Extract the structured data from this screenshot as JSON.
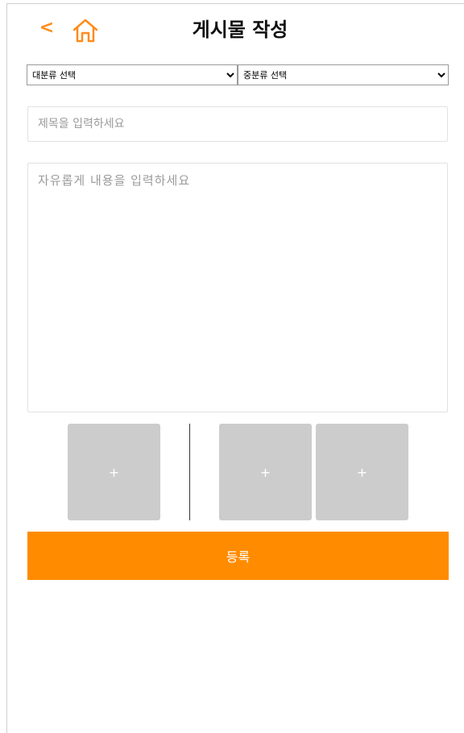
{
  "header": {
    "back_label": "<",
    "home_icon": "home-icon",
    "title": "게시물 작성"
  },
  "category": {
    "major_selected": "대분류 선택",
    "middle_selected": "중분류 선택"
  },
  "form": {
    "title_placeholder": "제목을 입력하세요",
    "title_value": "",
    "content_placeholder": "자유롭게 내용을 입력하세요",
    "content_value": ""
  },
  "images": {
    "slots": [
      {
        "label": "+"
      },
      {
        "label": "+"
      },
      {
        "label": "+"
      }
    ]
  },
  "actions": {
    "submit_label": "등록"
  },
  "colors": {
    "accent": "#ff8c00",
    "slot_bg": "#cccccc",
    "back_arrow": "#ff8c1a"
  }
}
